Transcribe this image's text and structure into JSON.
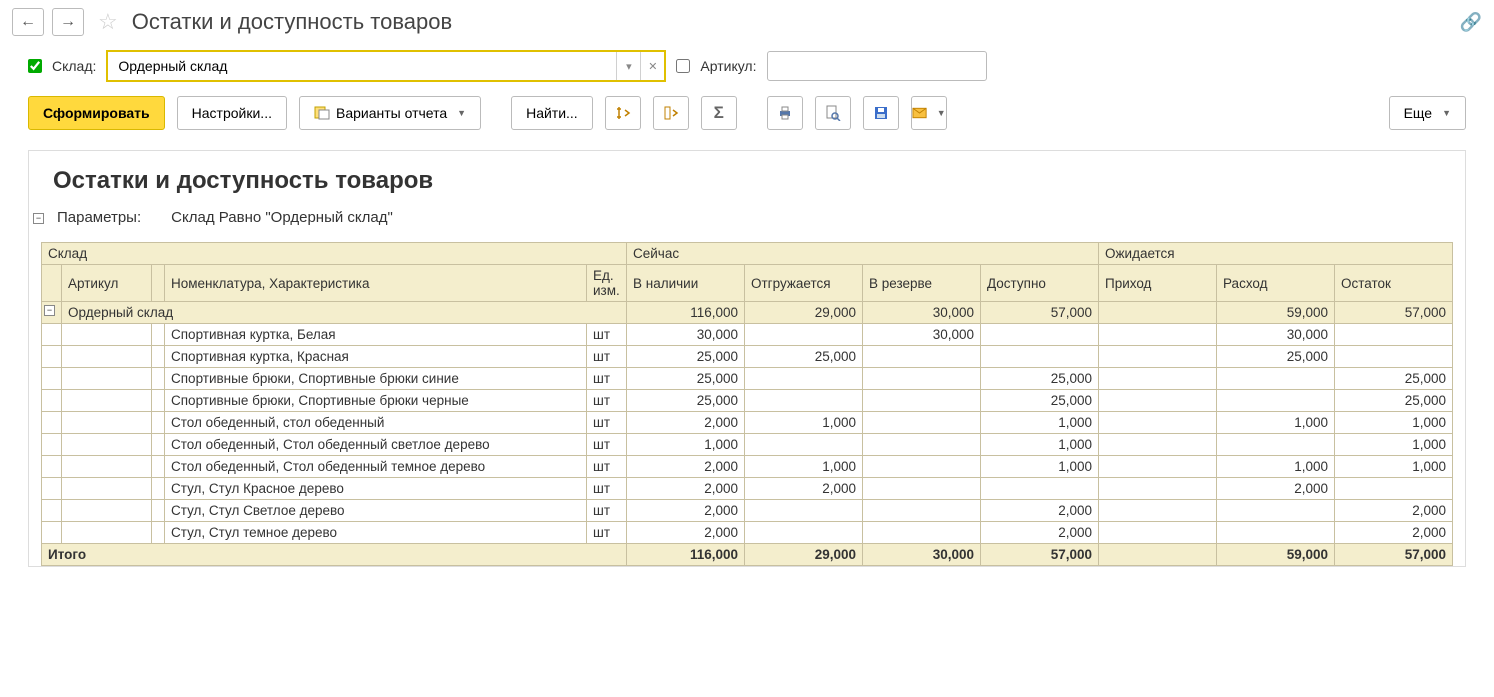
{
  "header": {
    "title": "Остатки и доступность товаров"
  },
  "filters": {
    "warehouse_label": "Склад:",
    "warehouse_value": "Ордерный склад",
    "article_label": "Артикул:",
    "article_value": ""
  },
  "toolbar": {
    "run": "Сформировать",
    "settings": "Настройки...",
    "variants": "Варианты отчета",
    "find": "Найти...",
    "more": "Еще"
  },
  "report": {
    "title": "Остатки и доступность товаров",
    "params_label": "Параметры:",
    "params_text": "Склад Равно \"Ордерный склад\"",
    "headers": {
      "warehouse": "Склад",
      "article": "Артикул",
      "nomen": "Номенклатура, Характеристика",
      "unit": "Ед. изм.",
      "now": "Сейчас",
      "in_stock": "В наличии",
      "shipping": "Отгружается",
      "reserved": "В резерве",
      "available": "Доступно",
      "expected": "Ожидается",
      "incoming": "Приход",
      "outgoing": "Расход",
      "balance": "Остаток"
    },
    "group": {
      "name": "Ордерный склад",
      "in_stock": "116,000",
      "shipping": "29,000",
      "reserved": "30,000",
      "available": "57,000",
      "incoming": "",
      "outgoing": "59,000",
      "balance": "57,000"
    },
    "rows": [
      {
        "article": "",
        "nomen": "Спортивная куртка, Белая",
        "unit": "шт",
        "in_stock": "30,000",
        "shipping": "",
        "reserved": "30,000",
        "available": "",
        "incoming": "",
        "outgoing": "30,000",
        "balance": ""
      },
      {
        "article": "",
        "nomen": "Спортивная куртка, Красная",
        "unit": "шт",
        "in_stock": "25,000",
        "shipping": "25,000",
        "reserved": "",
        "available": "",
        "incoming": "",
        "outgoing": "25,000",
        "balance": ""
      },
      {
        "article": "",
        "nomen": "Спортивные брюки, Спортивные брюки синие",
        "unit": "шт",
        "in_stock": "25,000",
        "shipping": "",
        "reserved": "",
        "available": "25,000",
        "incoming": "",
        "outgoing": "",
        "balance": "25,000"
      },
      {
        "article": "",
        "nomen": "Спортивные брюки, Спортивные брюки черные",
        "unit": "шт",
        "in_stock": "25,000",
        "shipping": "",
        "reserved": "",
        "available": "25,000",
        "incoming": "",
        "outgoing": "",
        "balance": "25,000"
      },
      {
        "article": "",
        "nomen": "Стол обеденный, стол обеденный",
        "unit": "шт",
        "in_stock": "2,000",
        "shipping": "1,000",
        "reserved": "",
        "available": "1,000",
        "incoming": "",
        "outgoing": "1,000",
        "balance": "1,000"
      },
      {
        "article": "",
        "nomen": "Стол обеденный, Стол обеденный светлое дерево",
        "unit": "шт",
        "in_stock": "1,000",
        "shipping": "",
        "reserved": "",
        "available": "1,000",
        "incoming": "",
        "outgoing": "",
        "balance": "1,000"
      },
      {
        "article": "",
        "nomen": "Стол обеденный, Стол обеденный темное дерево",
        "unit": "шт",
        "in_stock": "2,000",
        "shipping": "1,000",
        "reserved": "",
        "available": "1,000",
        "incoming": "",
        "outgoing": "1,000",
        "balance": "1,000"
      },
      {
        "article": "",
        "nomen": "Стул, Стул Красное дерево",
        "unit": "шт",
        "in_stock": "2,000",
        "shipping": "2,000",
        "reserved": "",
        "available": "",
        "incoming": "",
        "outgoing": "2,000",
        "balance": ""
      },
      {
        "article": "",
        "nomen": "Стул, Стул Светлое дерево",
        "unit": "шт",
        "in_stock": "2,000",
        "shipping": "",
        "reserved": "",
        "available": "2,000",
        "incoming": "",
        "outgoing": "",
        "balance": "2,000"
      },
      {
        "article": "",
        "nomen": "Стул, Стул темное дерево",
        "unit": "шт",
        "in_stock": "2,000",
        "shipping": "",
        "reserved": "",
        "available": "2,000",
        "incoming": "",
        "outgoing": "",
        "balance": "2,000"
      }
    ],
    "total": {
      "label": "Итого",
      "in_stock": "116,000",
      "shipping": "29,000",
      "reserved": "30,000",
      "available": "57,000",
      "incoming": "",
      "outgoing": "59,000",
      "balance": "57,000"
    }
  }
}
